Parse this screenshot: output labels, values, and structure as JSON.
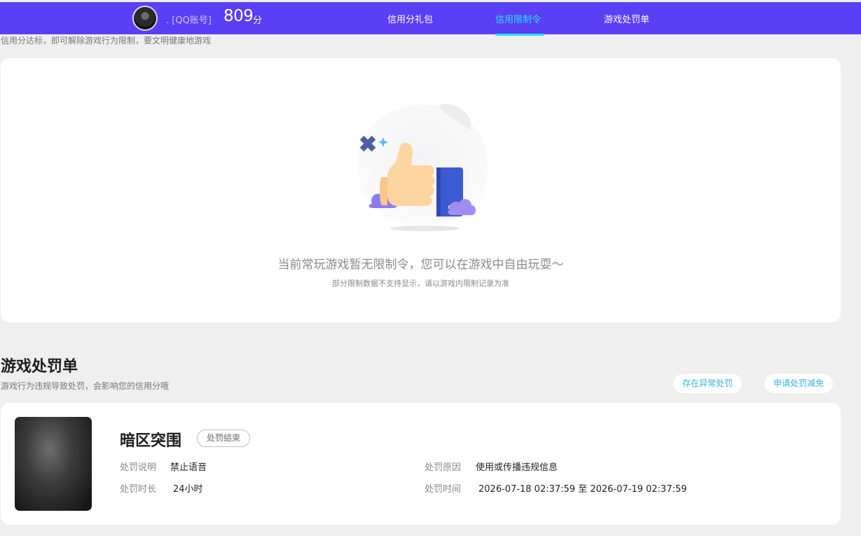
{
  "header": {
    "account_text": ". [QQ账号]",
    "score": "809",
    "score_unit": "分",
    "nav": [
      "信用分礼包",
      "信用限制令",
      "游戏处罚单"
    ],
    "active_nav": "信用限制令",
    "accent_color": "#5a3ff5",
    "active_color": "#28e0ff"
  },
  "restriction": {
    "tip": "信用分达标，即可解除游戏行为限制，要文明健康地游戏",
    "empty_title": "当前常玩游戏暂无限制令，您可以在游戏中自由玩耍～",
    "empty_subtitle": "部分限制数据不支持显示，请以游戏内限制记录为准",
    "illustration_icon": "thumbs-up-icon"
  },
  "punishment": {
    "title": "游戏处罚单",
    "subtitle": "游戏行为违规导致处罚，会影响您的信用分哦",
    "buttons": [
      "存在异常处罚",
      "申请处罚减免"
    ],
    "item": {
      "game": "暗区突围",
      "status": "处罚结束",
      "desc_label": "处罚说明",
      "desc_value": "禁止语音",
      "reason_label": "处罚原因",
      "reason_value": "使用或传播违规信息",
      "duration_label": "处罚时长",
      "duration_value": "24小时",
      "time_label": "处罚时间",
      "time_value": "2026-07-18 02:37:59 至 2026-07-19 02:37:59"
    }
  }
}
